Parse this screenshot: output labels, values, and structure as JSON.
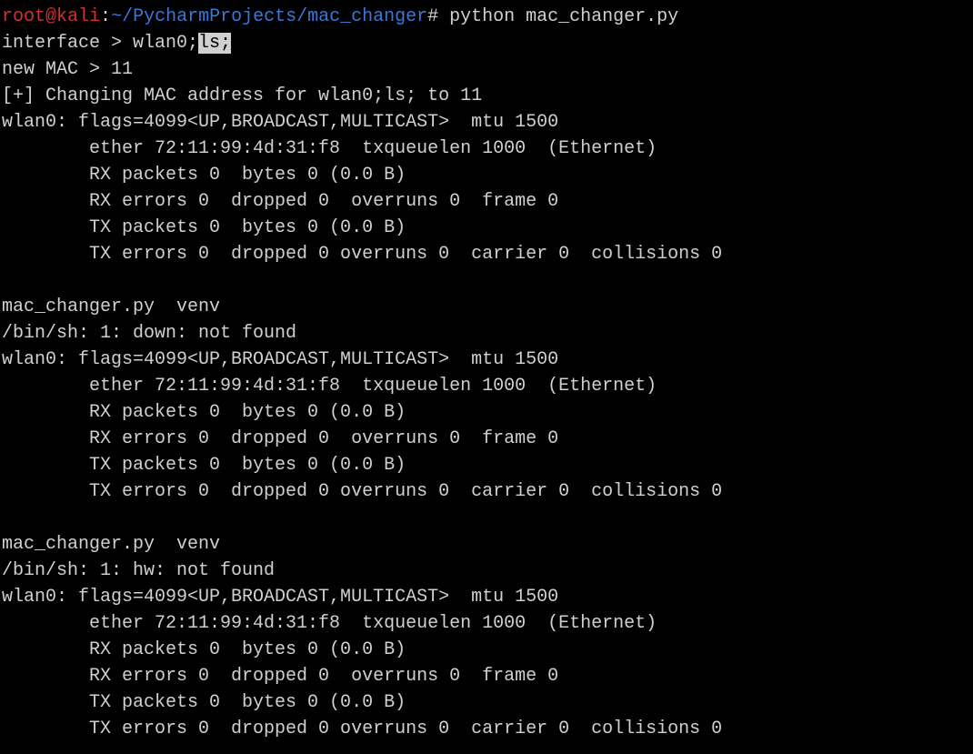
{
  "prompt": {
    "user": "root",
    "at": "@",
    "host": "kali",
    "colon": ":",
    "path": "~/PycharmProjects/mac_changer",
    "hash": "#",
    "command": " python mac_changer.py"
  },
  "input_lines": {
    "interface_prefix": "interface > wlan0;",
    "interface_highlight": "ls;",
    "new_mac": "new MAC > 11",
    "changing": "[+] Changing MAC address for wlan0;ls; to 11"
  },
  "ifconfig1": {
    "header": "wlan0: flags=4099<UP,BROADCAST,MULTICAST>  mtu 1500",
    "ether": "        ether 72:11:99:4d:31:f8  txqueuelen 1000  (Ethernet)",
    "rx_pk": "        RX packets 0  bytes 0 (0.0 B)",
    "rx_er": "        RX errors 0  dropped 0  overruns 0  frame 0",
    "tx_pk": "        TX packets 0  bytes 0 (0.0 B)",
    "tx_er": "        TX errors 0  dropped 0 overruns 0  carrier 0  collisions 0"
  },
  "blank1": " ",
  "ls1": "mac_changer.py  venv",
  "err1": "/bin/sh: 1: down: not found",
  "ifconfig2": {
    "header": "wlan0: flags=4099<UP,BROADCAST,MULTICAST>  mtu 1500",
    "ether": "        ether 72:11:99:4d:31:f8  txqueuelen 1000  (Ethernet)",
    "rx_pk": "        RX packets 0  bytes 0 (0.0 B)",
    "rx_er": "        RX errors 0  dropped 0  overruns 0  frame 0",
    "tx_pk": "        TX packets 0  bytes 0 (0.0 B)",
    "tx_er": "        TX errors 0  dropped 0 overruns 0  carrier 0  collisions 0"
  },
  "blank2": " ",
  "ls2": "mac_changer.py  venv",
  "err2": "/bin/sh: 1: hw: not found",
  "ifconfig3": {
    "header": "wlan0: flags=4099<UP,BROADCAST,MULTICAST>  mtu 1500",
    "ether": "        ether 72:11:99:4d:31:f8  txqueuelen 1000  (Ethernet)",
    "rx_pk": "        RX packets 0  bytes 0 (0.0 B)",
    "rx_er": "        RX errors 0  dropped 0  overruns 0  frame 0",
    "tx_pk": "        TX packets 0  bytes 0 (0.0 B)",
    "tx_er": "        TX errors 0  dropped 0 overruns 0  carrier 0  collisions 0"
  }
}
